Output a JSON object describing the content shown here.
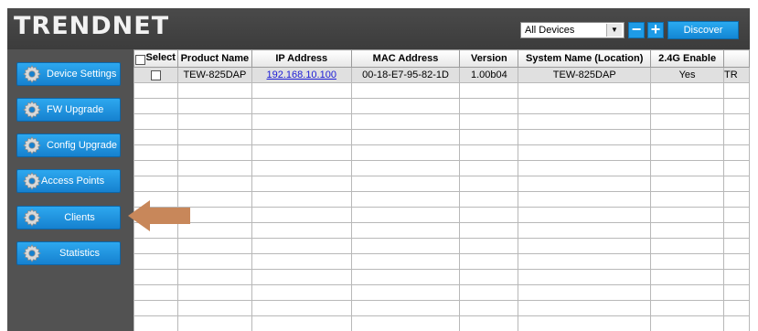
{
  "header": {
    "logo": "TRENDNET",
    "device_filter": "All Devices",
    "discover_label": "Discover",
    "minus_label": "−",
    "plus_label": "+"
  },
  "sidebar": {
    "items": [
      {
        "label": "Device Settings",
        "icon": "gear-icon"
      },
      {
        "label": "FW Upgrade",
        "icon": "gear-icon"
      },
      {
        "label": "Config Upgrade",
        "icon": "gear-icon"
      },
      {
        "label": "Access Points",
        "icon": "gear-icon"
      },
      {
        "label": "Clients",
        "icon": "gear-icon"
      },
      {
        "label": "Statistics",
        "icon": "gear-icon"
      }
    ]
  },
  "table": {
    "headers": [
      "Select",
      "Product Name",
      "IP Address",
      "MAC Address",
      "Version",
      "System Name (Location)",
      "2.4G Enable",
      ""
    ],
    "rows": [
      [
        "",
        "TEW-825DAP",
        "192.168.10.100",
        "00-18-E7-95-82-1D",
        "1.00b04",
        "TEW-825DAP",
        "Yes",
        "TR"
      ]
    ]
  },
  "colors": {
    "accent": "#1e9be6",
    "frame": "#525252",
    "annotation_arrow": "#c8875a"
  }
}
